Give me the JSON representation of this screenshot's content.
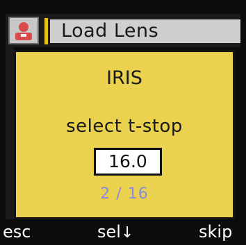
{
  "header": {
    "icon": "user-icon",
    "title": "Load Lens",
    "accent_color": "#e8c31c"
  },
  "dialog": {
    "title": "IRIS",
    "prompt": "select t-stop",
    "value": "16.0",
    "counter": "2 / 16",
    "background_color": "#ead24e",
    "counter_color": "#8b8ad8"
  },
  "softkeys": {
    "left": "esc",
    "center": "sel",
    "center_icon": "down-arrow-icon",
    "right": "skip"
  }
}
